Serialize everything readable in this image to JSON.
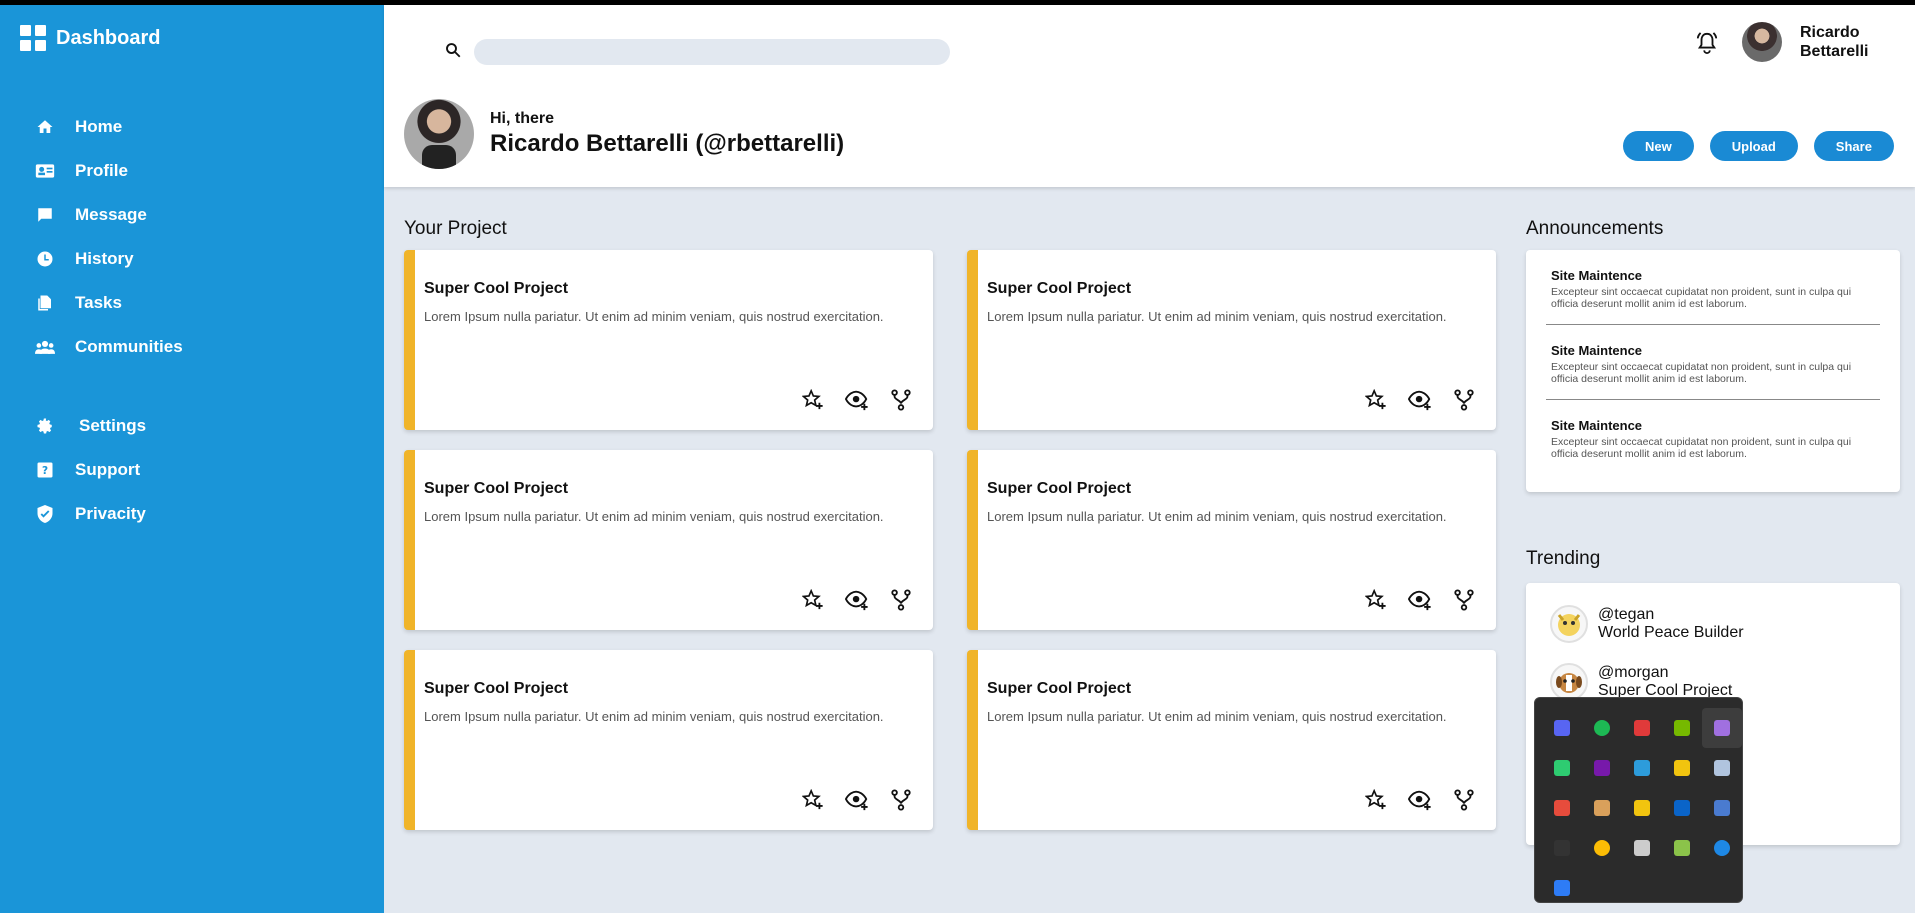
{
  "sidebar": {
    "brand": "Dashboard",
    "items": [
      {
        "label": "Home",
        "icon": "home-icon"
      },
      {
        "label": "Profile",
        "icon": "id-card-icon"
      },
      {
        "label": "Message",
        "icon": "message-icon"
      },
      {
        "label": "History",
        "icon": "clock-icon"
      },
      {
        "label": "Tasks",
        "icon": "documents-icon"
      },
      {
        "label": "Communities",
        "icon": "people-icon"
      }
    ],
    "secondary": [
      {
        "label": "Settings",
        "icon": "gear-icon"
      },
      {
        "label": "Support",
        "icon": "help-icon"
      },
      {
        "label": "Privacity",
        "icon": "shield-icon"
      }
    ]
  },
  "header": {
    "search_placeholder": "",
    "user_name": "Ricardo Bettarelli",
    "greeting": "Hi, there",
    "handle": "Ricardo Bettarelli (@rbettarelli)",
    "actions": [
      "New",
      "Upload",
      "Share"
    ]
  },
  "projects": {
    "title": "Your Project",
    "items": [
      {
        "title": "Super Cool Project",
        "desc": "Lorem Ipsum nulla pariatur. Ut enim ad minim veniam, quis nostrud exercitation."
      },
      {
        "title": "Super Cool Project",
        "desc": "Lorem Ipsum nulla pariatur. Ut enim ad minim veniam, quis nostrud exercitation."
      },
      {
        "title": "Super Cool Project",
        "desc": "Lorem Ipsum nulla pariatur. Ut enim ad minim veniam, quis nostrud exercitation."
      },
      {
        "title": "Super Cool Project",
        "desc": "Lorem Ipsum nulla pariatur. Ut enim ad minim veniam, quis nostrud exercitation."
      },
      {
        "title": "Super Cool Project",
        "desc": "Lorem Ipsum nulla pariatur. Ut enim ad minim veniam, quis nostrud exercitation."
      },
      {
        "title": "Super Cool Project",
        "desc": "Lorem Ipsum nulla pariatur. Ut enim ad minim veniam, quis nostrud exercitation."
      }
    ]
  },
  "announcements": {
    "title": "Announcements",
    "items": [
      {
        "title": "Site Maintence",
        "text": "Excepteur sint occaecat cupidatat non proident, sunt in culpa qui officia deserunt mollit anim id est laborum."
      },
      {
        "title": "Site Maintence",
        "text": "Excepteur sint occaecat cupidatat non proident, sunt in culpa qui officia deserunt mollit anim id est laborum."
      },
      {
        "title": "Site Maintence",
        "text": "Excepteur sint occaecat cupidatat non proident, sunt in culpa qui officia deserunt mollit anim id est laborum."
      }
    ]
  },
  "trending": {
    "title": "Trending",
    "items": [
      {
        "handle": "@tegan",
        "desc": "World Peace Builder"
      },
      {
        "handle": "@morgan",
        "desc": "Super Cool Project"
      }
    ]
  },
  "tray": {
    "icons": [
      {
        "name": "discord-icon",
        "color": "#5865f2"
      },
      {
        "name": "spotify-icon",
        "color": "#1db954"
      },
      {
        "name": "lightning-app-icon",
        "color": "#e03a3a"
      },
      {
        "name": "nvidia-icon",
        "color": "#76b900"
      },
      {
        "name": "feather-app-icon",
        "color": "#a070e0"
      },
      {
        "name": "k-app-icon",
        "color": "#2ecc71"
      },
      {
        "name": "onenote-icon",
        "color": "#7719aa"
      },
      {
        "name": "cloud-app-icon",
        "color": "#2d9cdb"
      },
      {
        "name": "photo-app-icon",
        "color": "#f1c40f"
      },
      {
        "name": "penguin-app-icon",
        "color": "#b0c4de"
      },
      {
        "name": "remote-app-icon",
        "color": "#e74c3c"
      },
      {
        "name": "mail-app-icon",
        "color": "#d9a05b"
      },
      {
        "name": "lock-app-icon",
        "color": "#f1c40f"
      },
      {
        "name": "outlook-icon",
        "color": "#0a64c8"
      },
      {
        "name": "teams-app-icon",
        "color": "#4a7bd0"
      },
      {
        "name": "epic-games-icon",
        "color": "#333333"
      },
      {
        "name": "chrome-icon",
        "color": "#fbbc05"
      },
      {
        "name": "window-app-icon",
        "color": "#cccccc"
      },
      {
        "name": "monitor-app-icon",
        "color": "#8bc34a"
      },
      {
        "name": "bluetooth-icon",
        "color": "#1e88e5"
      },
      {
        "name": "defender-icon",
        "color": "#2e7cf6"
      }
    ]
  }
}
